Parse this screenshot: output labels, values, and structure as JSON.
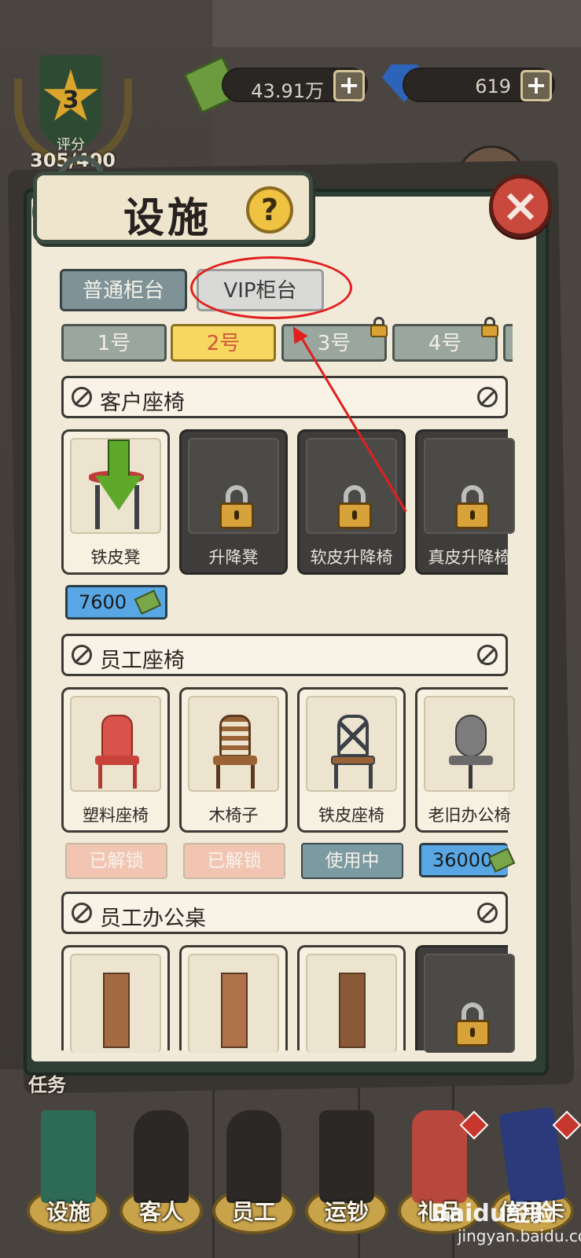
{
  "hud": {
    "rating": {
      "value": "3",
      "label": "评分",
      "score": "305/400"
    },
    "cash": {
      "amount": "43.91万",
      "plus": "+"
    },
    "gems": {
      "amount": "619",
      "plus": "+"
    }
  },
  "dialog": {
    "title": "设施",
    "help": "?",
    "close": "×",
    "tabs": [
      {
        "label": "普通柜台",
        "active": true
      },
      {
        "label": "VIP柜台",
        "active": false
      }
    ],
    "counters": [
      {
        "label": "1号",
        "locked": false
      },
      {
        "label": "2号",
        "locked": false,
        "active": true
      },
      {
        "label": "3号",
        "locked": true
      },
      {
        "label": "4号",
        "locked": true
      }
    ],
    "sections": {
      "customer_seats": {
        "title": "客户座椅",
        "items": [
          {
            "name": "铁皮凳",
            "locked": false,
            "price": "7600"
          },
          {
            "name": "升降凳",
            "locked": true
          },
          {
            "name": "软皮升降椅",
            "locked": true
          },
          {
            "name": "真皮升降椅",
            "locked": true
          }
        ]
      },
      "staff_seats": {
        "title": "员工座椅",
        "items": [
          {
            "name": "塑料座椅",
            "status": "已解锁"
          },
          {
            "name": "木椅子",
            "status": "已解锁"
          },
          {
            "name": "铁皮座椅",
            "status": "使用中"
          },
          {
            "name": "老旧办公椅",
            "price": "36000"
          }
        ]
      },
      "staff_desks": {
        "title": "员工办公桌",
        "items": [
          {
            "name": "",
            "locked": false
          },
          {
            "name": "",
            "locked": false
          },
          {
            "name": "",
            "locked": false
          },
          {
            "name": "",
            "locked": true
          }
        ]
      }
    }
  },
  "nav": [
    {
      "label": "设施"
    },
    {
      "label": "客人"
    },
    {
      "label": "员工"
    },
    {
      "label": "运钞"
    },
    {
      "label": "礼品"
    },
    {
      "label": "信用卡"
    }
  ],
  "side_label": "任务",
  "watermark": {
    "brand": "Baidu经验",
    "url": "jingyan.baidu.com"
  },
  "colors": {
    "active_tab": "#f7d760",
    "price": "#58a7e4",
    "unlocked": "#f2c5b3",
    "in_use": "#7b9aa1",
    "annotation": "#e11f1f"
  }
}
